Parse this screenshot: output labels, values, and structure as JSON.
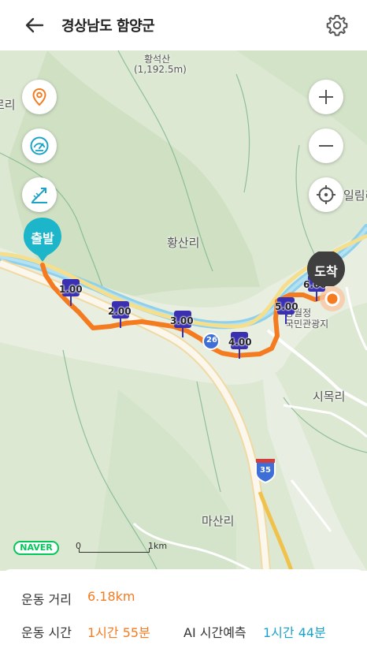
{
  "header": {
    "title": "경상남도 함양군"
  },
  "map": {
    "labels": {
      "peak_name": "황석산",
      "peak_height": "(1,192.5m)",
      "village_1": "황산리",
      "village_2": "시목리",
      "village_3": "마산리",
      "village_partial_left": "로리",
      "village_partial_right": "일림리",
      "park_1": "농월정",
      "park_2": "국민관광지",
      "road_26": "26",
      "road_35": "35"
    },
    "markers": [
      {
        "label": "1.00"
      },
      {
        "label": "2.00"
      },
      {
        "label": "3.00"
      },
      {
        "label": "4.00"
      },
      {
        "label": "5.00"
      },
      {
        "label": "6.00"
      }
    ],
    "start_label": "출발",
    "end_label": "도착",
    "provider": "NAVER",
    "scale": {
      "zero": "0",
      "unit": "1km"
    },
    "colors": {
      "route": "#f47b20",
      "start": "#1cb5c9",
      "end": "#444444",
      "marker": "#3a2fb0"
    }
  },
  "stats": {
    "distance_label": "운동 거리",
    "distance_value": "6.18km",
    "time_label": "운동 시간",
    "time_value": "1시간 55분",
    "ai_label": "AI 시간예측",
    "ai_value": "1시간 44분"
  }
}
